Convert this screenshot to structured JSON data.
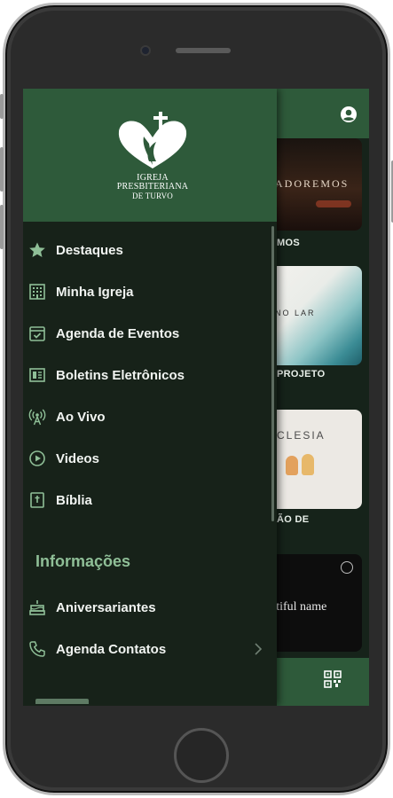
{
  "logo": {
    "line1": "IGREJA",
    "line2": "PRESBITERIANA",
    "line3": "DE TURVO"
  },
  "menu": {
    "items": [
      {
        "label": "Destaques",
        "icon": "star-icon"
      },
      {
        "label": "Minha Igreja",
        "icon": "building-icon"
      },
      {
        "label": "Agenda de Eventos",
        "icon": "calendar-icon"
      },
      {
        "label": "Boletins Eletrônicos",
        "icon": "newspaper-icon"
      },
      {
        "label": "Ao Vivo",
        "icon": "broadcast-icon"
      },
      {
        "label": "Videos",
        "icon": "play-icon"
      },
      {
        "label": "Bíblia",
        "icon": "bible-icon"
      }
    ],
    "section_title": "Informações",
    "info_items": [
      {
        "label": "Aniversariantes",
        "icon": "cake-icon"
      },
      {
        "label": "Agenda Contatos",
        "icon": "phone-icon"
      }
    ]
  },
  "background": {
    "card1_text": "ADOREMOS",
    "card1_label": "MOS",
    "card2_text": "NO LAR",
    "card2_label": "PROJETO",
    "card3_text": "CLESIA",
    "card3_label": "ÃO DE",
    "card4_text": "autiful name"
  },
  "colors": {
    "primary": "#2e5a3a",
    "drawer_bg": "#172219",
    "section": "#8fbf97"
  }
}
